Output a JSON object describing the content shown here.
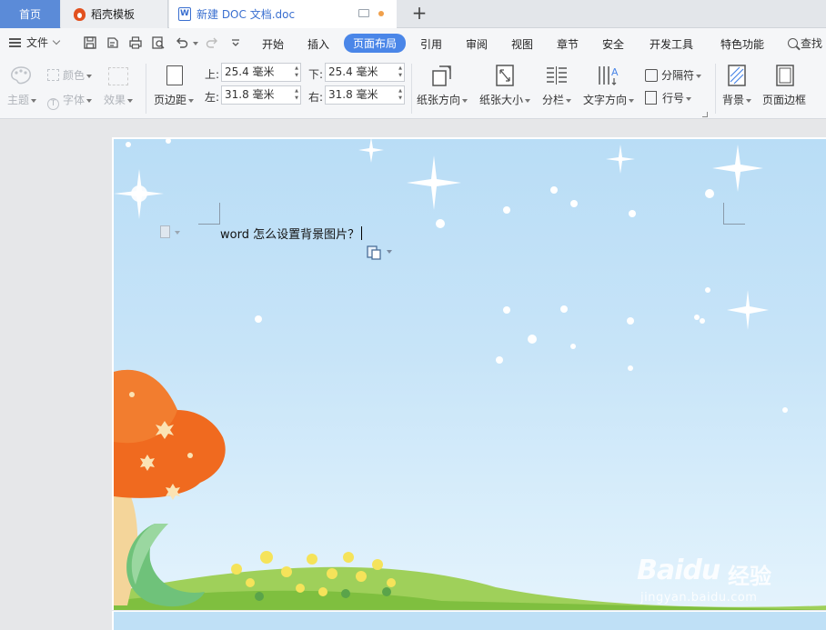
{
  "tabs": {
    "home": "首页",
    "template": "稻壳模板",
    "document": "新建 DOC 文档.doc",
    "add": "+"
  },
  "menu": {
    "file": "文件",
    "items": [
      "开始",
      "插入",
      "页面布局",
      "引用",
      "审阅",
      "视图",
      "章节",
      "安全",
      "开发工具",
      "特色功能"
    ],
    "active": "页面布局",
    "search": "查找"
  },
  "ribbon": {
    "theme": "主题",
    "color": "颜色",
    "font": "字体",
    "effect": "效果",
    "margins": "页边距",
    "top_label": "上:",
    "top_value": "25.4 毫米",
    "bottom_label": "下:",
    "bottom_value": "25.4 毫米",
    "left_label": "左:",
    "left_value": "31.8 毫米",
    "right_label": "右:",
    "right_value": "31.8 毫米",
    "orientation": "纸张方向",
    "size": "纸张大小",
    "columns": "分栏",
    "text_direction": "文字方向",
    "breaks": "分隔符",
    "line_numbers": "行号",
    "background": "背景",
    "page_border": "页面边框"
  },
  "document": {
    "text": "word 怎么设置背景图片？"
  },
  "watermark": {
    "logo": "Baidu",
    "chinese": "经验",
    "url": "jingyan.baidu.com"
  },
  "colors": {
    "accent": "#4a86e8",
    "home_tab": "#5b8bd8",
    "sky": "#c7e4f8",
    "mushroom": "#f06a1f",
    "grass": "#8cc63f"
  }
}
